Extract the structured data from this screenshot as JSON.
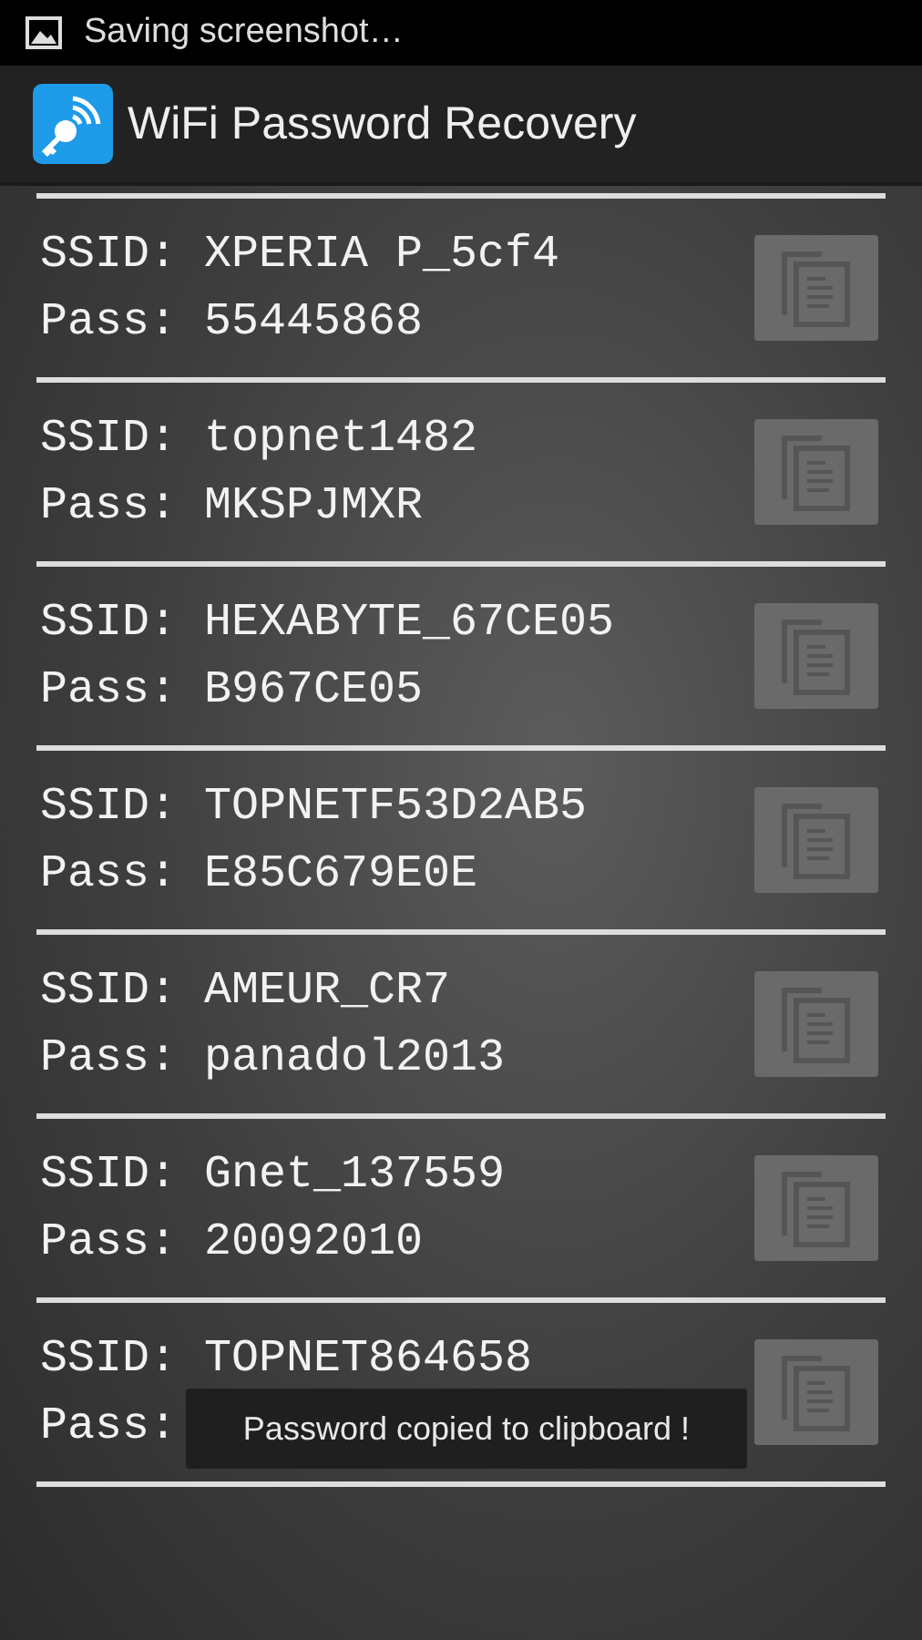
{
  "status_bar": {
    "notification": "Saving screenshot…"
  },
  "action_bar": {
    "title": "WiFi Password Recovery"
  },
  "networks": [
    {
      "ssid_label": "SSID:",
      "ssid": "XPERIA P_5cf4",
      "pass_label": "Pass:",
      "password": "55445868"
    },
    {
      "ssid_label": "SSID:",
      "ssid": "topnet1482",
      "pass_label": "Pass:",
      "password": "MKSPJMXR"
    },
    {
      "ssid_label": "SSID:",
      "ssid": "HEXABYTE_67CE05",
      "pass_label": "Pass:",
      "password": "B967CE05"
    },
    {
      "ssid_label": "SSID:",
      "ssid": "TOPNETF53D2AB5",
      "pass_label": "Pass:",
      "password": "E85C679E0E"
    },
    {
      "ssid_label": "SSID:",
      "ssid": "AMEUR_CR7",
      "pass_label": "Pass:",
      "password": "panadol2013"
    },
    {
      "ssid_label": "SSID:",
      "ssid": "Gnet_137559",
      "pass_label": "Pass:",
      "password": "20092010"
    },
    {
      "ssid_label": "SSID:",
      "ssid": "TOPNET864658",
      "pass_label": "Pass:"
    }
  ],
  "toast": "Password copied to clipboard !"
}
